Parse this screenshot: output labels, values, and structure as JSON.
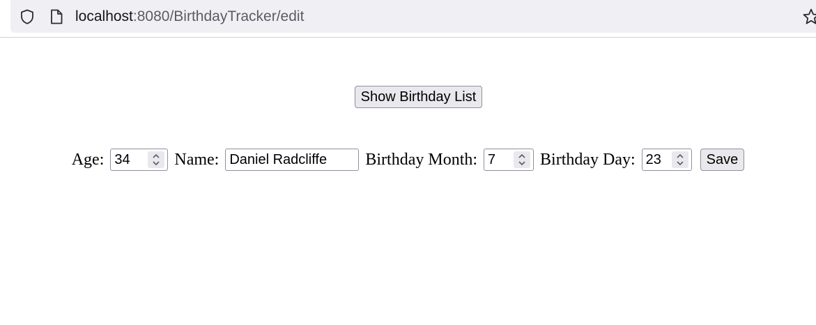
{
  "browser": {
    "url_host": "localhost",
    "url_rest": ":8080/BirthdayTracker/edit"
  },
  "page": {
    "show_list_button": "Show Birthday List",
    "form": {
      "age_label": "Age:",
      "age_value": "34",
      "name_label": "Name:",
      "name_value": "Daniel Radcliffe",
      "month_label": "Birthday Month:",
      "month_value": "7",
      "day_label": "Birthday Day:",
      "day_value": "23",
      "save_button": "Save"
    }
  },
  "icons": {
    "url_bar": [
      "shield-icon",
      "page-icon",
      "star-icon"
    ],
    "spinner": "chevron-up-down-icon"
  }
}
